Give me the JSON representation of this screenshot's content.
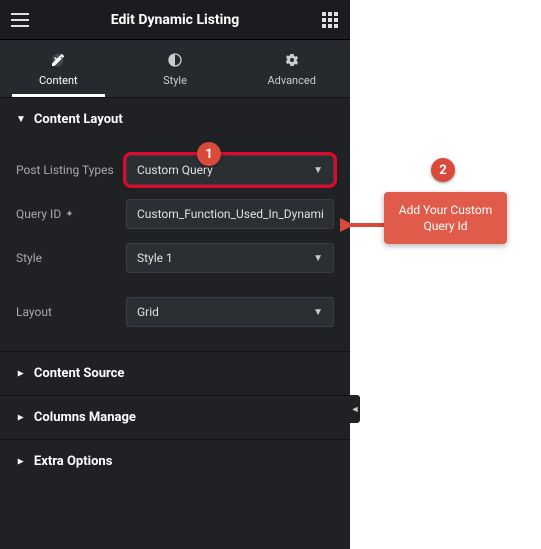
{
  "topbar": {
    "title": "Edit Dynamic Listing"
  },
  "tabs": {
    "content": "Content",
    "style": "Style",
    "advanced": "Advanced"
  },
  "sections": {
    "content_layout": "Content Layout",
    "content_source": "Content Source",
    "columns_manage": "Columns Manage",
    "extra_options": "Extra Options"
  },
  "fields": {
    "post_listing_types": {
      "label": "Post Listing Types",
      "value": "Custom Query"
    },
    "query_id": {
      "label": "Query ID",
      "value": "Custom_Function_Used_In_Dynamic_Listing"
    },
    "style": {
      "label": "Style",
      "value": "Style 1"
    },
    "layout": {
      "label": "Layout",
      "value": "Grid"
    }
  },
  "annotations": {
    "badge1": "1",
    "badge2": "2",
    "callout": "Add Your Custom Query Id"
  }
}
